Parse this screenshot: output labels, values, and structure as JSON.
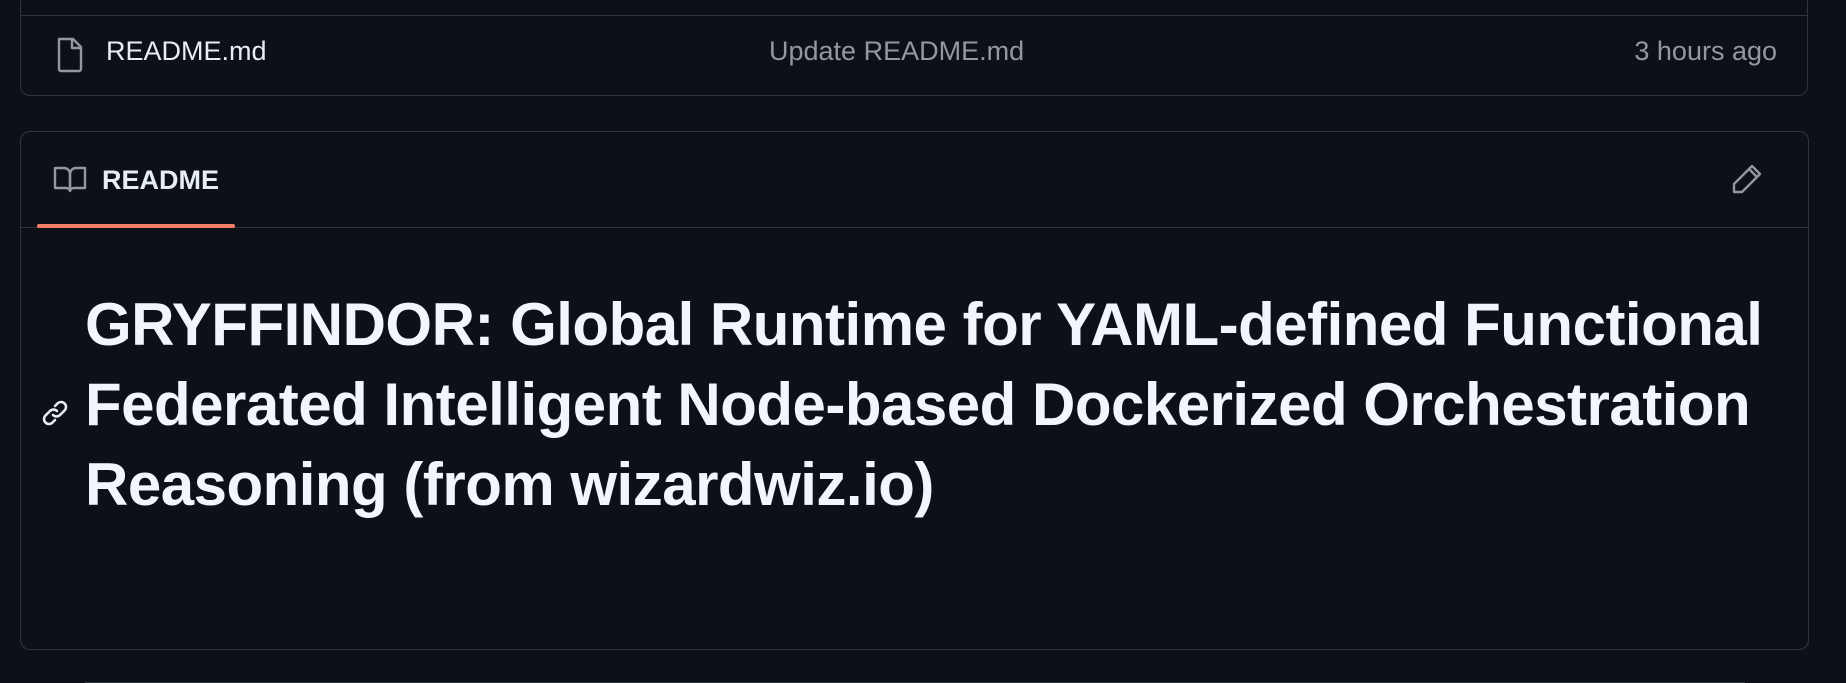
{
  "file_list": {
    "rows": [
      {
        "icon": "file-icon",
        "name": "README.md",
        "commit_message": "Update README.md",
        "time": "3 hours ago"
      }
    ]
  },
  "readme": {
    "tab_label": "README",
    "tab_icon": "book-icon",
    "edit_icon": "pencil-icon",
    "anchor_icon": "link-icon",
    "heading": "GRYFFINDOR: Global Runtime for YAML-defined Functional Federated Intelligent Node-based Dockerized Orchestration Reasoning (from wizardwiz.io)"
  },
  "colors": {
    "background": "#0d1117",
    "border": "#30363d",
    "text": "#e6edf3",
    "muted": "#9198a1",
    "tab_accent": "#f78166"
  }
}
